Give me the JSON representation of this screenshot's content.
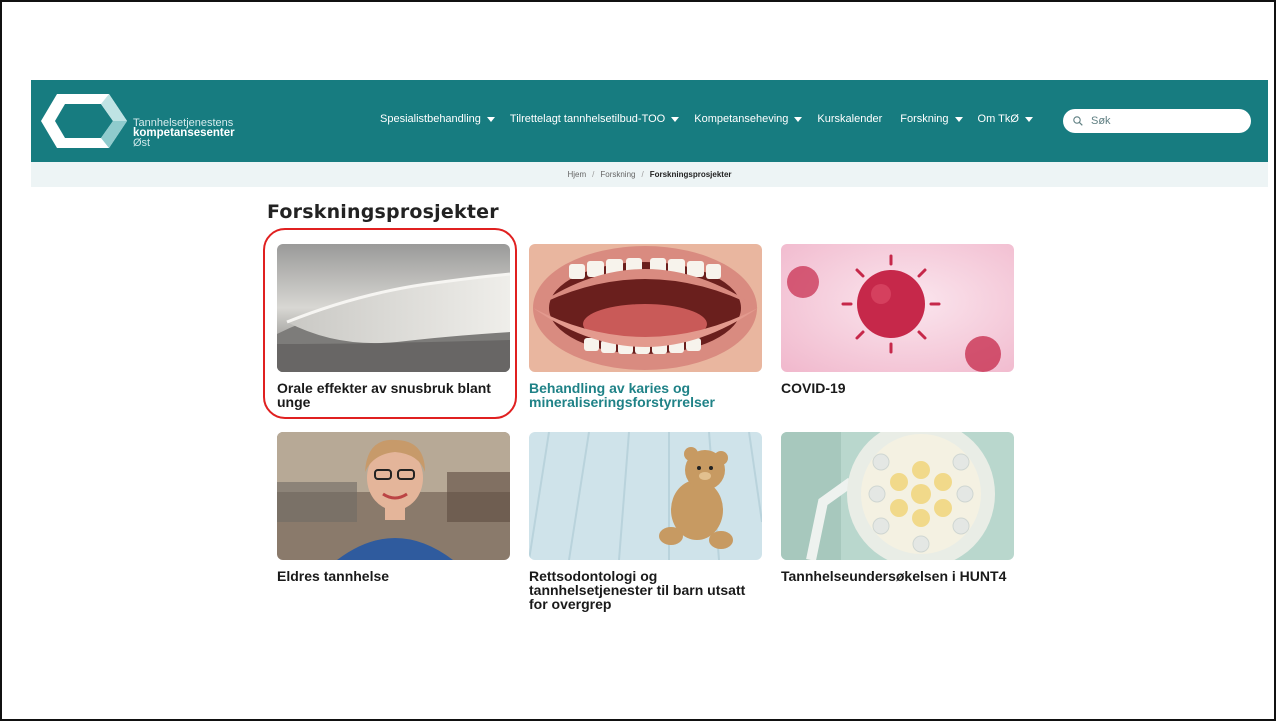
{
  "brand": {
    "line1": "Tannhelsetjenestens",
    "line2": "kompetansesenter",
    "line3": "Øst"
  },
  "nav": [
    {
      "label": "Spesialistbehandling",
      "dropdown": true
    },
    {
      "label": "Tilrettelagt tannhelsetilbud-TOO",
      "dropdown": true
    },
    {
      "label": "Kompetanseheving",
      "dropdown": true
    },
    {
      "label": "Kurskalender",
      "dropdown": false
    },
    {
      "label": "Forskning",
      "dropdown": true
    },
    {
      "label": "Om TkØ",
      "dropdown": true
    }
  ],
  "search": {
    "placeholder": "Søk"
  },
  "breadcrumb": {
    "home": "Hjem",
    "section": "Forskning",
    "current": "Forskningsprosjekter"
  },
  "page": {
    "title": "Forskningsprosjekter"
  },
  "cards": [
    {
      "title": "Orale effekter av snusbruk blant unge",
      "image": "snus-pouch-photo"
    },
    {
      "title": "Behandling av karies og mineraliseringsforstyrrelser",
      "image": "open-mouth-teeth-photo"
    },
    {
      "title": "COVID-19",
      "image": "virus-particles-illustration"
    },
    {
      "title": "Eldres tannhelse",
      "image": "smiling-older-woman-photo"
    },
    {
      "title": "Rettsodontologi og tannhelsetjenester til barn utsatt for overgrep",
      "image": "teddy-bear-photo"
    },
    {
      "title": "Tannhelseundersøkelsen i HUNT4",
      "image": "surgical-lamp-photo"
    }
  ],
  "colors": {
    "header": "#177c80",
    "breadcrumb_bg": "#edf4f5",
    "link": "#1f8287",
    "highlight": "#e02020"
  }
}
